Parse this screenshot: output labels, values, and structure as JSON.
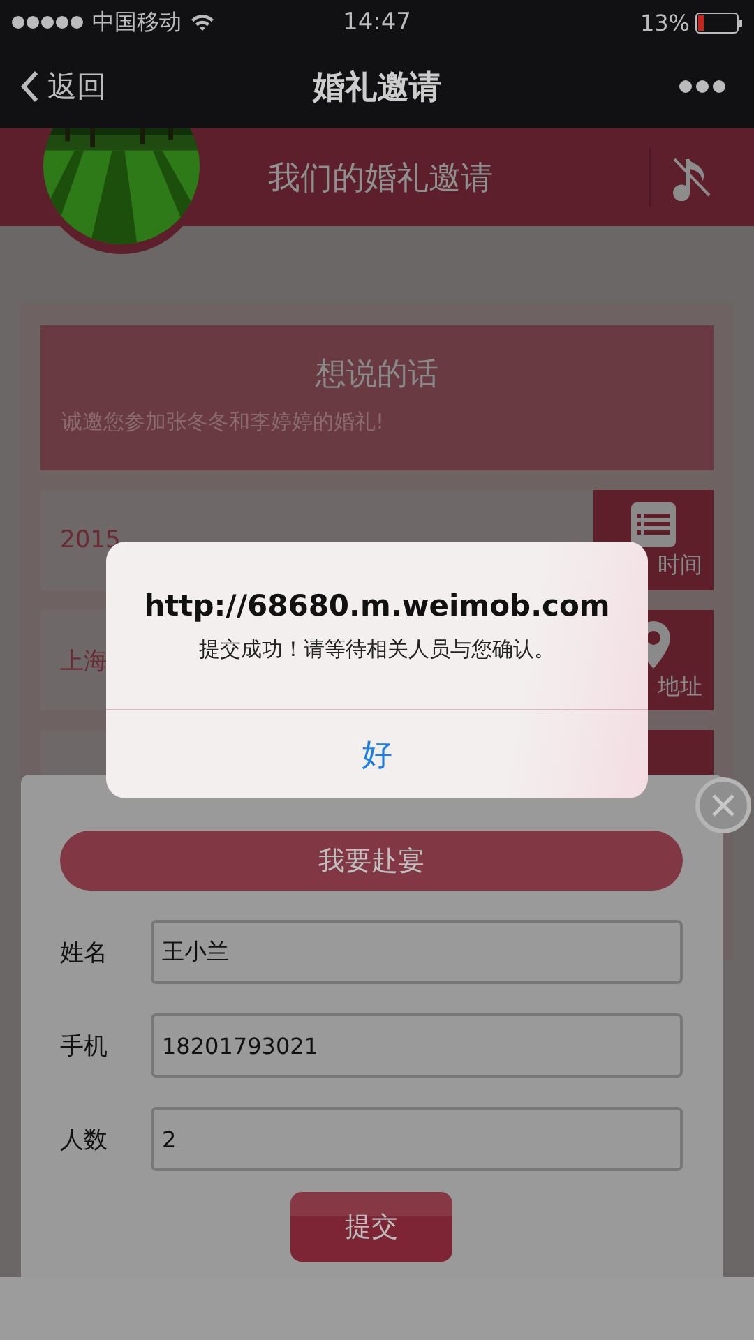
{
  "status_bar": {
    "carrier": "中国移动",
    "time": "14:47",
    "battery": "13%"
  },
  "nav": {
    "back": "返回",
    "title": "婚礼邀请"
  },
  "header": {
    "title": "我们的婚礼邀请"
  },
  "message_card": {
    "title": "想说的话",
    "text": "诚邀您参加张冬冬和李婷婷的婚礼!"
  },
  "info_rows": [
    {
      "kind": "time",
      "value": "2015",
      "label": "时间"
    },
    {
      "kind": "location",
      "value": "上海",
      "label": "地址"
    },
    {
      "kind": "other"
    }
  ],
  "rsvp_sheet": {
    "heading": "我要赴宴",
    "fields": [
      {
        "label": "姓名",
        "value": "王小兰"
      },
      {
        "label": "手机",
        "value": "18201793021"
      },
      {
        "label": "人数",
        "value": "2"
      }
    ],
    "submit": "提交"
  },
  "alert": {
    "title": "http://68680.m.weimob.com",
    "message": "提交成功！请等待相关人员与您确认。",
    "button": "好"
  }
}
